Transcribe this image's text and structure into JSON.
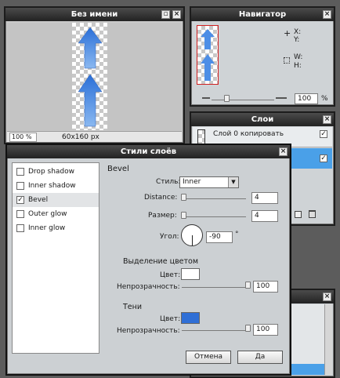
{
  "doc_window": {
    "title": "Без имени",
    "zoom": "100 %",
    "size": "60x160 px",
    "max_icon": "maximize-icon",
    "close_icon": "close-icon"
  },
  "navigator": {
    "title": "Навигатор",
    "x_label": "X:",
    "y_label": "Y:",
    "w_label": "W:",
    "h_label": "H:",
    "zoom_value": "100",
    "zoom_unit": "%"
  },
  "layers": {
    "title": "Слои",
    "layer1_name": "Слой 0 копировать"
  },
  "dialog": {
    "title": "Стили слоёв",
    "effects": [
      {
        "label": "Drop shadow",
        "checked": false
      },
      {
        "label": "Inner shadow",
        "checked": false
      },
      {
        "label": "Bevel",
        "checked": true
      },
      {
        "label": "Outer glow",
        "checked": false
      },
      {
        "label": "Inner glow",
        "checked": false
      }
    ],
    "section_title": "Bevel",
    "style_label": "Стиль:",
    "style_value": "Inner",
    "distance_label": "Distance:",
    "distance_value": "4",
    "size_label": "Размер:",
    "size_value": "4",
    "angle_label": "Угол:",
    "angle_value": "-90",
    "angle_unit": "°",
    "highlight_title": "Выделение цветом",
    "highlight_color_label": "Цвет:",
    "highlight_color": "#ffffff",
    "highlight_opacity_label": "Непрозрачность:",
    "highlight_opacity_value": "100",
    "shadow_title": "Тени",
    "shadow_color_label": "Цвет:",
    "shadow_color": "#2f6fd6",
    "shadow_opacity_label": "Непрозрачность:",
    "shadow_opacity_value": "100",
    "cancel_label": "Отмена",
    "ok_label": "Да"
  },
  "colors": {
    "title_bg": "#2a2a2a",
    "panel_bg": "#cfd3d6",
    "selection": "#4aa0e8"
  }
}
